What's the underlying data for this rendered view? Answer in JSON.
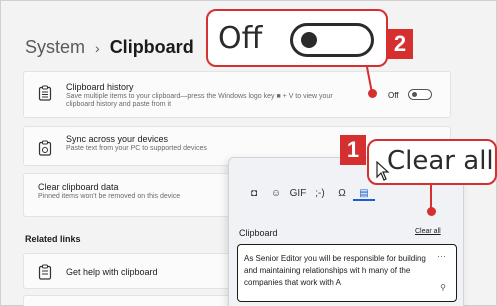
{
  "breadcrumb": {
    "parent": "System",
    "separator": "›",
    "current": "Clipboard"
  },
  "cards": {
    "history": {
      "title": "Clipboard history",
      "desc": "Save multiple items to your clipboard—press the Windows logo key ■ + V to view your clipboard history and paste from it",
      "toggle_label": "Off",
      "toggle_state": "off"
    },
    "sync": {
      "title": "Sync across your devices",
      "desc": "Paste text from your PC to supported devices"
    },
    "clear": {
      "title": "Clear clipboard data",
      "desc": "Pinned items won't be removed on this device"
    },
    "help": {
      "title": "Get help with clipboard"
    }
  },
  "related_links": "Related links",
  "flyout": {
    "tabs": [
      "emoji-sticker",
      "emoji",
      "gif",
      "kaomoji",
      "symbols",
      "clipboard"
    ],
    "tab_glyphs": [
      "◘",
      "☺",
      "GIF",
      ";-)",
      "Ω",
      "▤"
    ],
    "active_tab": "clipboard",
    "title": "Clipboard",
    "clear_all": "Clear all",
    "item_text": "As Senior Editor you will be responsible for building and maintaining relationships wit h many of the companies that work with A",
    "item_more": "···",
    "item_pin": "⚲"
  },
  "callouts": {
    "top": {
      "label": "Off",
      "badge": "2",
      "toggle_state": "off"
    },
    "right": {
      "label": "Clear all",
      "badge": "1"
    }
  },
  "colors": {
    "accent": "#d62f2f",
    "link": "#1b5fd1"
  }
}
